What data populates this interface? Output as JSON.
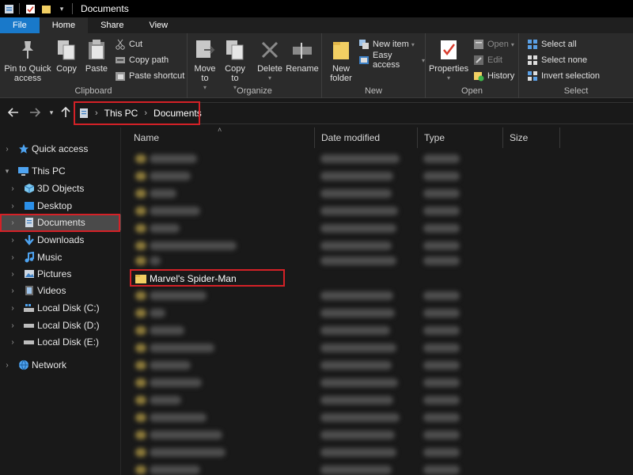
{
  "window": {
    "title": "Documents"
  },
  "ribbon": {
    "tabs": [
      "File",
      "Home",
      "Share",
      "View"
    ],
    "clipboard": {
      "label": "Clipboard",
      "pin": "Pin to Quick access",
      "copy": "Copy",
      "paste": "Paste",
      "cut": "Cut",
      "copy_path": "Copy path",
      "paste_shortcut": "Paste shortcut"
    },
    "organize": {
      "label": "Organize",
      "move_to": "Move to",
      "copy_to": "Copy to",
      "delete": "Delete",
      "rename": "Rename"
    },
    "new": {
      "label": "New",
      "new_folder": "New folder",
      "new_item": "New item",
      "easy_access": "Easy access"
    },
    "open": {
      "label": "Open",
      "properties": "Properties",
      "open": "Open",
      "edit": "Edit",
      "history": "History"
    },
    "select": {
      "label": "Select",
      "select_all": "Select all",
      "select_none": "Select none",
      "invert": "Invert selection"
    }
  },
  "address": {
    "crumbs": [
      "This PC",
      "Documents"
    ]
  },
  "navpane": {
    "quick_access": "Quick access",
    "this_pc": "This PC",
    "items": [
      "3D Objects",
      "Desktop",
      "Documents",
      "Downloads",
      "Music",
      "Pictures",
      "Videos",
      "Local Disk (C:)",
      "Local Disk (D:)",
      "Local Disk (E:)"
    ],
    "network": "Network"
  },
  "filelist": {
    "columns": [
      "Name",
      "Date modified",
      "Type",
      "Size"
    ],
    "highlighted": "Marvel's Spider-Man"
  },
  "colors": {
    "accent": "#1979ca",
    "highlight": "#d42127",
    "folder": "#f2cf63"
  }
}
